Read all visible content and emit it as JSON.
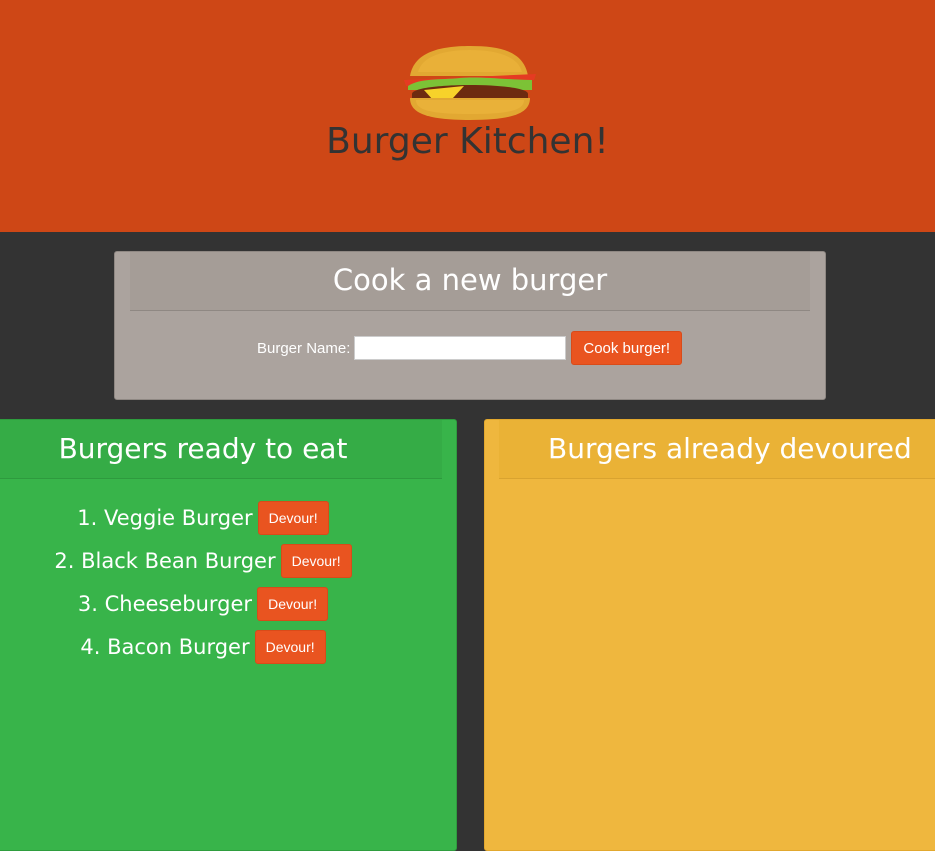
{
  "header": {
    "title": "Burger Kitchen!",
    "logo_icon": "burger-icon",
    "background_color": "#ce4716"
  },
  "cook_panel": {
    "heading": "Cook a new burger",
    "label": "Burger Name:",
    "input_value": "",
    "button_label": "Cook burger!"
  },
  "ready_panel": {
    "heading": "Burgers ready to eat",
    "items": [
      {
        "number": "1.",
        "name": "Veggie Burger",
        "button_label": "Devour!"
      },
      {
        "number": "2.",
        "name": "Black Bean Burger",
        "button_label": "Devour!"
      },
      {
        "number": "3.",
        "name": "Cheeseburger",
        "button_label": "Devour!"
      },
      {
        "number": "4.",
        "name": "Bacon Burger",
        "button_label": "Devour!"
      }
    ],
    "background_color": "#38b44a"
  },
  "devoured_panel": {
    "heading": "Burgers already devoured",
    "items": [],
    "background_color": "#efb73e"
  },
  "colors": {
    "button": "#e95420",
    "page_background": "#333333",
    "cook_panel": "#aba39e"
  }
}
